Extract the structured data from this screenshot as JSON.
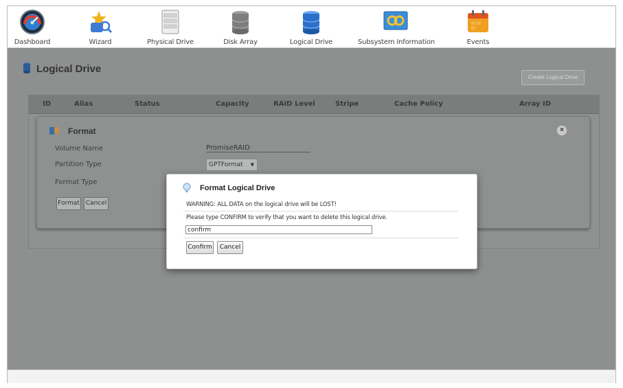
{
  "toolbar": {
    "items": [
      {
        "label": "Dashboard",
        "icon": "dashboard-gauge-icon"
      },
      {
        "label": "Wizard",
        "icon": "wizard-icon"
      },
      {
        "label": "Physical Drive",
        "icon": "physical-drive-icon"
      },
      {
        "label": "Disk Array",
        "icon": "disk-array-icon"
      },
      {
        "label": "Logical Drive",
        "icon": "logical-drive-icon"
      },
      {
        "label": "Subsystem Information",
        "icon": "subsystem-info-icon"
      },
      {
        "label": "Events",
        "icon": "events-calendar-icon"
      }
    ]
  },
  "page": {
    "title": "Logical Drive",
    "create_button": "Create Logical Drive"
  },
  "table": {
    "columns": [
      "ID",
      "Alias",
      "Status",
      "Capacity",
      "RAID Level",
      "Stripe",
      "Cache Policy",
      "Array ID"
    ]
  },
  "format_panel": {
    "title": "Format",
    "volume_name_label": "Volume Name",
    "volume_name_value": "PromiseRAID",
    "partition_type_label": "Partition Type",
    "partition_type_value": "GPTFormat",
    "format_type_label": "Format Type",
    "format_button": "Format",
    "cancel_button": "Cancel",
    "close_symbol": "×"
  },
  "dialog": {
    "title": "Format Logical Drive",
    "warning": "WARNING: ALL DATA on the logical drive will be LOST!",
    "instruction": "Please type CONFIRM to verify that you want to delete this logical drive.",
    "input_value": "confirm",
    "confirm_button": "Confirm",
    "cancel_button": "Cancel"
  },
  "colors": {
    "overlay_gray": "#8e9090",
    "dialog_bg": "#ffffff",
    "drive_blue": "#2a6fc9",
    "events_orange": "#f0a020"
  }
}
